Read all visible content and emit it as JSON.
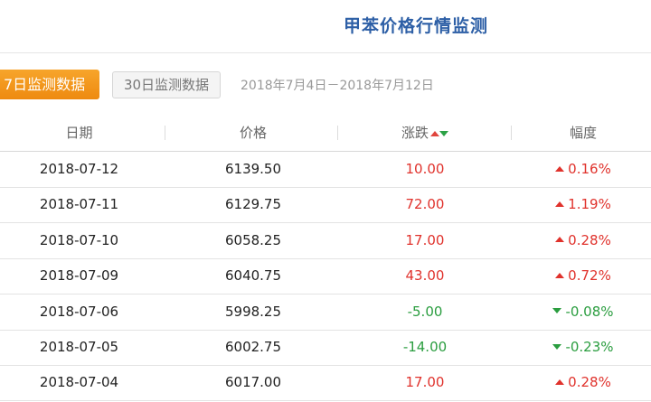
{
  "header": {
    "title": "甲苯价格行情监测"
  },
  "toolbar": {
    "btn_7_label": "7日监测数据",
    "btn_30_label": "30日监测数据",
    "date_range": "2018年7月4日－2018年7月12日"
  },
  "table": {
    "columns": [
      "日期",
      "价格",
      "涨跌",
      "幅度"
    ],
    "rows": [
      {
        "date": "2018-07-12",
        "price": "6139.50",
        "change": "10.00",
        "pct": "0.16%",
        "dir": "up"
      },
      {
        "date": "2018-07-11",
        "price": "6129.75",
        "change": "72.00",
        "pct": "1.19%",
        "dir": "up"
      },
      {
        "date": "2018-07-10",
        "price": "6058.25",
        "change": "17.00",
        "pct": "0.28%",
        "dir": "up"
      },
      {
        "date": "2018-07-09",
        "price": "6040.75",
        "change": "43.00",
        "pct": "0.72%",
        "dir": "up"
      },
      {
        "date": "2018-07-06",
        "price": "5998.25",
        "change": "-5.00",
        "pct": "-0.08%",
        "dir": "down"
      },
      {
        "date": "2018-07-05",
        "price": "6002.75",
        "change": "-14.00",
        "pct": "-0.23%",
        "dir": "down"
      },
      {
        "date": "2018-07-04",
        "price": "6017.00",
        "change": "17.00",
        "pct": "0.28%",
        "dir": "up"
      }
    ]
  },
  "colors": {
    "up": "#e0322c",
    "down": "#2a9d3f",
    "title": "#2d5fa6",
    "accent": "#ee8a10"
  },
  "icons": {
    "up": "triangle-up-icon",
    "down": "triangle-down-icon"
  }
}
